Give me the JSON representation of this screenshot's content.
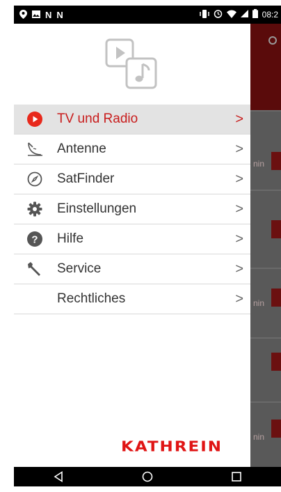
{
  "status_bar": {
    "time": "08:2",
    "left_icons": [
      "location-icon",
      "image-icon",
      "n-notification-icon",
      "n-notification-icon"
    ],
    "right_icons": [
      "vibrate-icon",
      "alarm-icon",
      "wifi-icon",
      "signal-icon",
      "battery-icon"
    ]
  },
  "drawer": {
    "logo_icon": "media-logo-icon",
    "items": [
      {
        "label": "TV und Radio",
        "icon": "play-circle-icon",
        "active": true
      },
      {
        "label": "Antenne",
        "icon": "antenna-icon",
        "active": false
      },
      {
        "label": "SatFinder",
        "icon": "compass-icon",
        "active": false
      },
      {
        "label": "Einstellungen",
        "icon": "gear-icon",
        "active": false
      },
      {
        "label": "Hilfe",
        "icon": "help-icon",
        "active": false
      },
      {
        "label": "Service",
        "icon": "wrench-icon",
        "active": false
      },
      {
        "label": "Rechtliches",
        "icon": "",
        "active": false
      }
    ],
    "chevron": ">",
    "brand": "KATHREIN",
    "colors": {
      "accent": "#c81c1c",
      "brand": "#e01414",
      "active_bg": "#e3e3e3"
    }
  },
  "background_app": {
    "row_texts": [
      "nin",
      "nin",
      "nin"
    ]
  },
  "nav_bar": {
    "buttons": [
      "back-icon",
      "home-icon",
      "recents-icon"
    ]
  }
}
